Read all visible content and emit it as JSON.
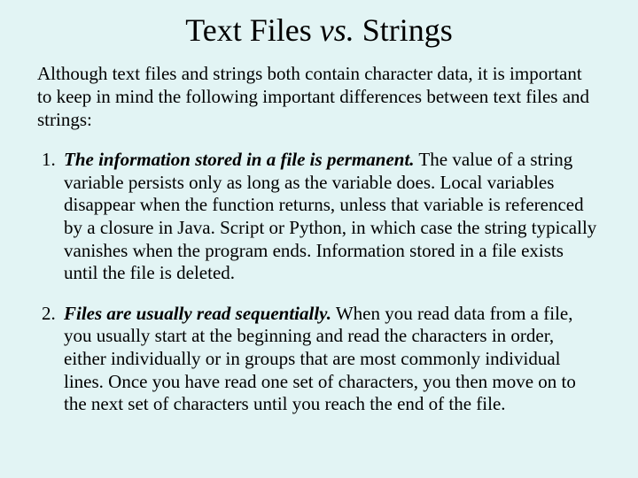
{
  "title_part1": "Text Files ",
  "title_vs": "vs.",
  "title_part2": " Strings",
  "intro": "Although text files and strings both contain character data, it is important to keep in mind the following important differences between text files and strings:",
  "points": [
    {
      "lead": "The information stored in a file is permanent.",
      "body": "  The value of a string variable persists only as long as the variable does.  Local variables disappear when the function returns, unless that variable is referenced by a closure in Java. Script or Python, in which case the string typically vanishes when the program ends.  Information stored in a file exists until the file is deleted."
    },
    {
      "lead": "Files are usually read sequentially.",
      "body": " When you read data from a file, you usually start at the beginning and read the characters in order, either individually or in groups that are most commonly individual lines.  Once you have read one set of characters, you then move on to the next set of characters until you reach the end of the file."
    }
  ]
}
